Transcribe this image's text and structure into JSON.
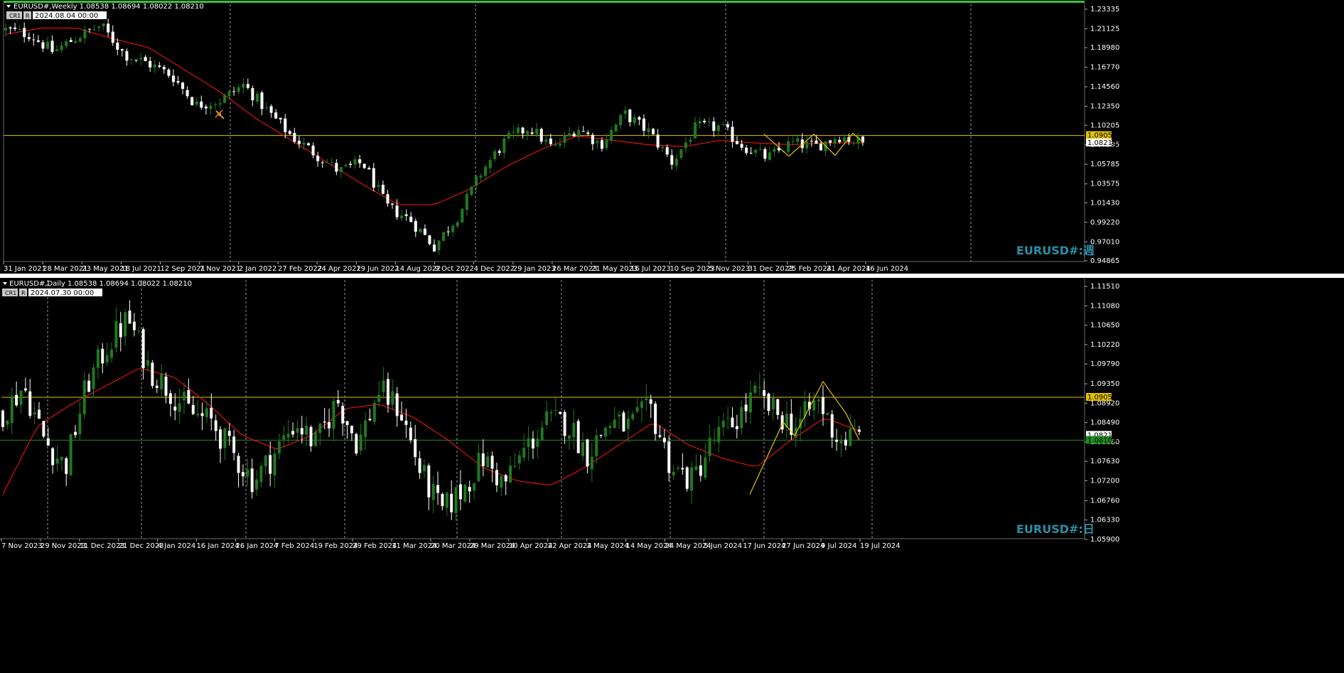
{
  "panels": [
    {
      "symbol_header": "EURUSD#,Weekly  1.08538 1.08694 1.08022 1.08210",
      "badges": [
        "CR1",
        "R"
      ],
      "date_box": "2024.08.04 00:00",
      "watermark": "EURUSD#:週"
    },
    {
      "symbol_header": "EURUSD#,Daily  1.08538 1.08694 1.08022 1.08210",
      "badges": [
        "CR1",
        "R"
      ],
      "date_box": "2024.07.30 00:00",
      "watermark": "EURUSD#:日"
    }
  ],
  "colors": {
    "background": "#000000",
    "bull": "#1f7a1f",
    "bear": "#ffffff",
    "ma": "#e01010",
    "level": "#e5c100",
    "green_line": "#1d8f1d",
    "top_bar": "#3fbf3f",
    "watermark": "#2a8fa6"
  },
  "chart_data": [
    {
      "type": "candlestick",
      "timeframe": "Weekly",
      "x_labels": [
        "31 Jan 2021",
        "28 Mar 2021",
        "23 May 2021",
        "18 Jul 2021",
        "12 Sep 2021",
        "7 Nov 2021",
        "2 Jan 2022",
        "27 Feb 2022",
        "24 Apr 2022",
        "19 Jun 2022",
        "14 Aug 2022",
        "9 Oct 2022",
        "4 Dec 2022",
        "29 Jan 2023",
        "26 Mar 2023",
        "21 May 2023",
        "16 Jul 2023",
        "10 Sep 2023",
        "5 Nov 2023",
        "31 Dec 2023",
        "25 Feb 2024",
        "21 Apr 2024",
        "16 Jun 2024"
      ],
      "y_ticks": [
        1.23335,
        1.21125,
        1.1898,
        1.1677,
        1.1456,
        1.1235,
        1.10205,
        1.07995,
        1.05785,
        1.03575,
        1.0143,
        0.9922,
        0.9701,
        0.94865
      ],
      "ylim": [
        0.94865,
        1.23335
      ],
      "level_line": 1.09052,
      "level_label": "1.09052",
      "last_price": 1.0821,
      "last_price_label": "1.08210",
      "anchors": [
        1.21,
        1.205,
        1.185,
        1.202,
        1.215,
        1.182,
        1.172,
        1.158,
        1.125,
        1.13,
        1.148,
        1.118,
        1.09,
        1.07,
        1.05,
        1.06,
        1.01,
        0.995,
        0.965,
        1.0,
        1.05,
        1.085,
        1.1,
        1.075,
        1.1,
        1.08,
        1.115,
        1.095,
        1.06,
        1.1,
        1.1,
        1.078,
        1.065,
        1.082,
        1.078,
        1.09,
        1.082
      ],
      "ma_anchors": [
        1.205,
        1.212,
        1.212,
        1.2,
        1.19,
        1.165,
        1.14,
        1.11,
        1.085,
        1.06,
        1.035,
        1.012,
        1.012,
        1.03,
        1.055,
        1.075,
        1.09,
        1.085,
        1.08,
        1.078,
        1.085,
        1.082,
        1.08,
        1.082,
        1.082
      ]
    },
    {
      "type": "candlestick",
      "timeframe": "Daily",
      "x_labels": [
        "7 Nov 2023",
        "29 Nov 2023",
        "11 Dec 2023",
        "21 Dec 2023",
        "4 Jan 2024",
        "16 Jan 2024",
        "26 Jan 2024",
        "7 Feb 2024",
        "19 Feb 2024",
        "29 Feb 2024",
        "11 Mar 2024",
        "20 Mar 2024",
        "29 Mar 2024",
        "10 Apr 2024",
        "22 Apr 2024",
        "2 May 2024",
        "14 May 2024",
        "24 May 2024",
        "5 Jun 2024",
        "17 Jun 2024",
        "27 Jun 2024",
        "9 Jul 2024",
        "19 Jul 2024"
      ],
      "y_ticks": [
        1.1151,
        1.1108,
        1.1065,
        1.1022,
        1.0979,
        1.0935,
        1.0892,
        1.0849,
        1.0806,
        1.0763,
        1.072,
        1.0676,
        1.0633,
        1.059
      ],
      "ylim": [
        1.059,
        1.1151
      ],
      "level_line": 1.09052,
      "level_label": "1.09052",
      "last_price": 1.0821,
      "last_price_label": "1.08210",
      "green_line": 1.081,
      "green_label": "1.08100",
      "anchors": [
        1.087,
        1.093,
        1.081,
        1.075,
        1.093,
        1.102,
        1.108,
        1.097,
        1.092,
        1.087,
        1.085,
        1.078,
        1.072,
        1.078,
        1.085,
        1.08,
        1.09,
        1.08,
        1.092,
        1.088,
        1.074,
        1.065,
        1.07,
        1.077,
        1.071,
        1.079,
        1.085,
        1.085,
        1.078,
        1.085,
        1.084,
        1.088,
        1.075,
        1.072,
        1.081,
        1.085,
        1.091,
        1.087,
        1.084,
        1.09,
        1.081,
        1.082
      ],
      "ma_anchors": [
        1.069,
        1.084,
        1.089,
        1.093,
        1.097,
        1.095,
        1.089,
        1.082,
        1.079,
        1.082,
        1.088,
        1.089,
        1.086,
        1.081,
        1.075,
        1.072,
        1.071,
        1.075,
        1.08,
        1.085,
        1.08,
        1.077,
        1.075,
        1.081,
        1.086,
        1.083
      ],
      "zigzag": [
        1.069,
        1.085,
        1.082,
        1.094,
        1.087,
        1.081
      ]
    }
  ]
}
